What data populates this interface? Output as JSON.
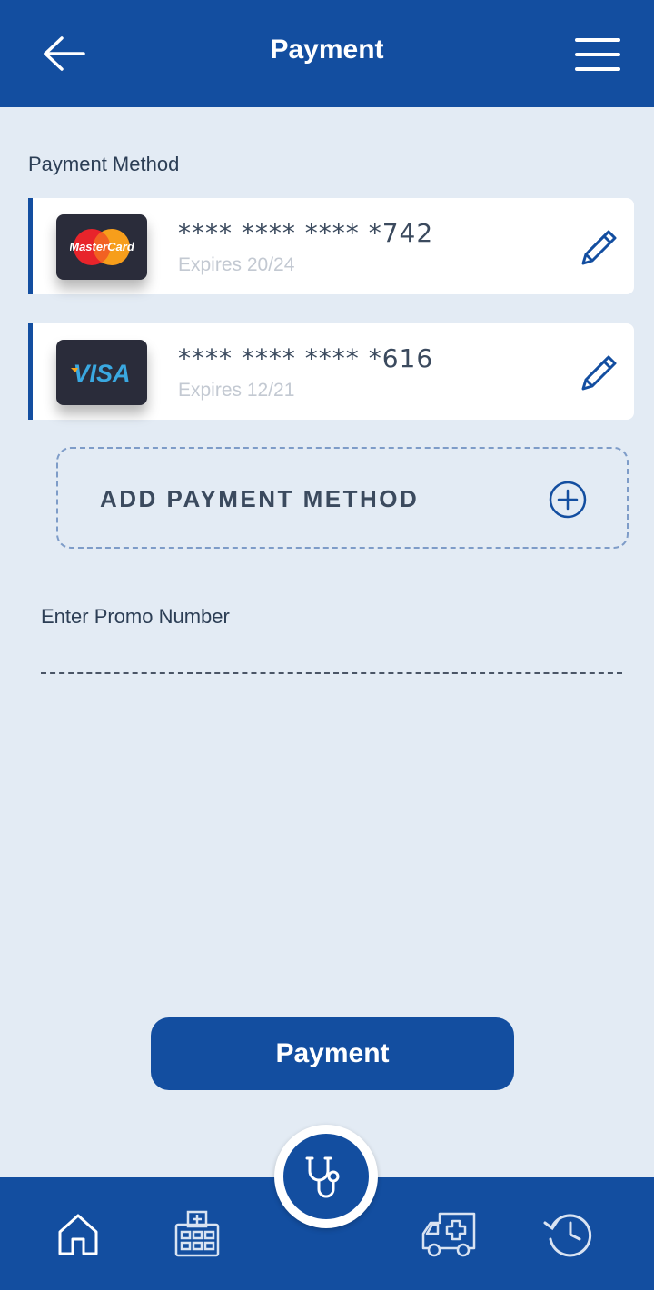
{
  "header": {
    "title": "Payment"
  },
  "payment_section": {
    "label": "Payment Method"
  },
  "cards": [
    {
      "brand": "MasterCard",
      "number": "**** **** **** *742",
      "expiry": "Expires 20/24"
    },
    {
      "brand": "VISA",
      "number": "**** **** **** *616",
      "expiry": "Expires 12/21"
    }
  ],
  "add_payment": {
    "label": "ADD PAYMENT METHOD"
  },
  "promo": {
    "label": "Enter Promo Number",
    "value": ""
  },
  "pay_button": {
    "label": "Payment"
  },
  "nav": {
    "items": [
      {
        "icon": "home-icon"
      },
      {
        "icon": "hospital-icon"
      },
      {
        "icon": "stethoscope-icon"
      },
      {
        "icon": "ambulance-icon"
      },
      {
        "icon": "history-icon"
      }
    ]
  },
  "colors": {
    "primary": "#134ea0",
    "background": "#e3ebf4",
    "card_bg": "#2a2c3a"
  }
}
